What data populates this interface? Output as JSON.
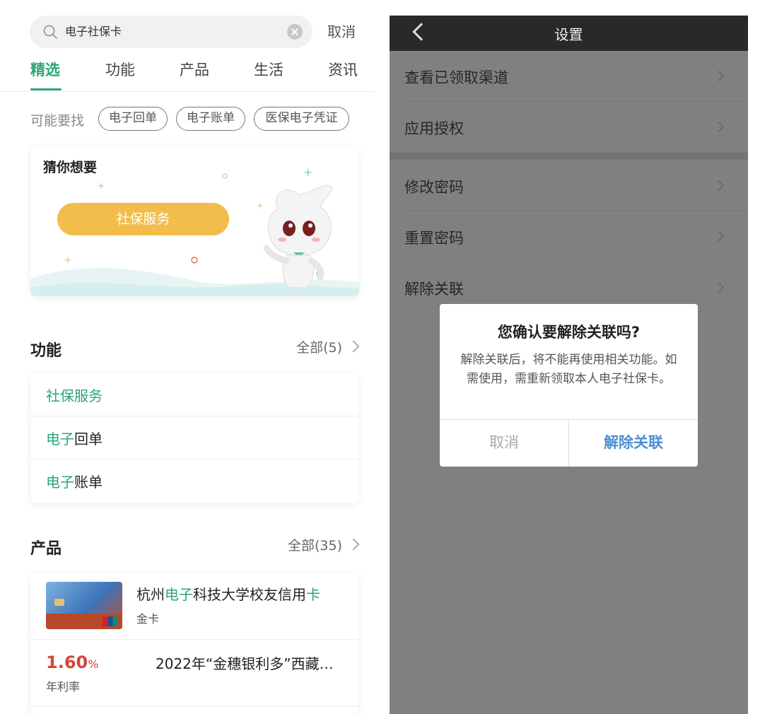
{
  "left": {
    "search": {
      "query": "电子社保卡",
      "cancel_label": "取消"
    },
    "tabs": [
      {
        "label": "精选",
        "active": true
      },
      {
        "label": "功能",
        "active": false
      },
      {
        "label": "产品",
        "active": false
      },
      {
        "label": "生活",
        "active": false
      },
      {
        "label": "资讯",
        "active": false
      }
    ],
    "maybe": {
      "label": "可能要找",
      "chips": [
        "电子回单",
        "电子账单",
        "医保电子凭证"
      ]
    },
    "guess": {
      "title": "猜你想要",
      "button_label": "社保服务"
    },
    "functions": {
      "title": "功能",
      "more_label": "全部(5)",
      "items": [
        {
          "highlight": "社保服务",
          "rest": ""
        },
        {
          "highlight": "电子",
          "rest": "回单"
        },
        {
          "highlight": "电子",
          "rest": "账单"
        }
      ]
    },
    "products": {
      "title": "产品",
      "more_label": "全部(35)",
      "card": {
        "name_pre": "杭州",
        "name_hl1": "电子",
        "name_mid": "科技大学校友信用",
        "name_hl2": "卡",
        "sub": "金卡"
      },
      "deposit": {
        "rate_value": "1.60",
        "rate_unit": "%",
        "rate_label": "年利率",
        "name": "2022年“金穗银利多”西藏…"
      }
    }
  },
  "right": {
    "nav_title": "设置",
    "items": [
      {
        "label": "查看已领取渠道"
      },
      {
        "label": "应用授权"
      },
      {
        "label": "修改密码"
      },
      {
        "label": "重置密码"
      },
      {
        "label": "解除关联"
      }
    ],
    "dialog": {
      "title": "您确认要解除关联吗?",
      "body": "解除关联后，将不能再使用相关功能。如需使用，需重新领取本人电子社保卡。",
      "cancel_label": "取消",
      "confirm_label": "解除关联"
    }
  },
  "colors": {
    "accent_green": "#2aa574",
    "button_yellow": "#f2bd4a",
    "rate_red": "#d4473e",
    "dialog_blue": "#4b8fd0",
    "overlay_gray": "#808080"
  }
}
